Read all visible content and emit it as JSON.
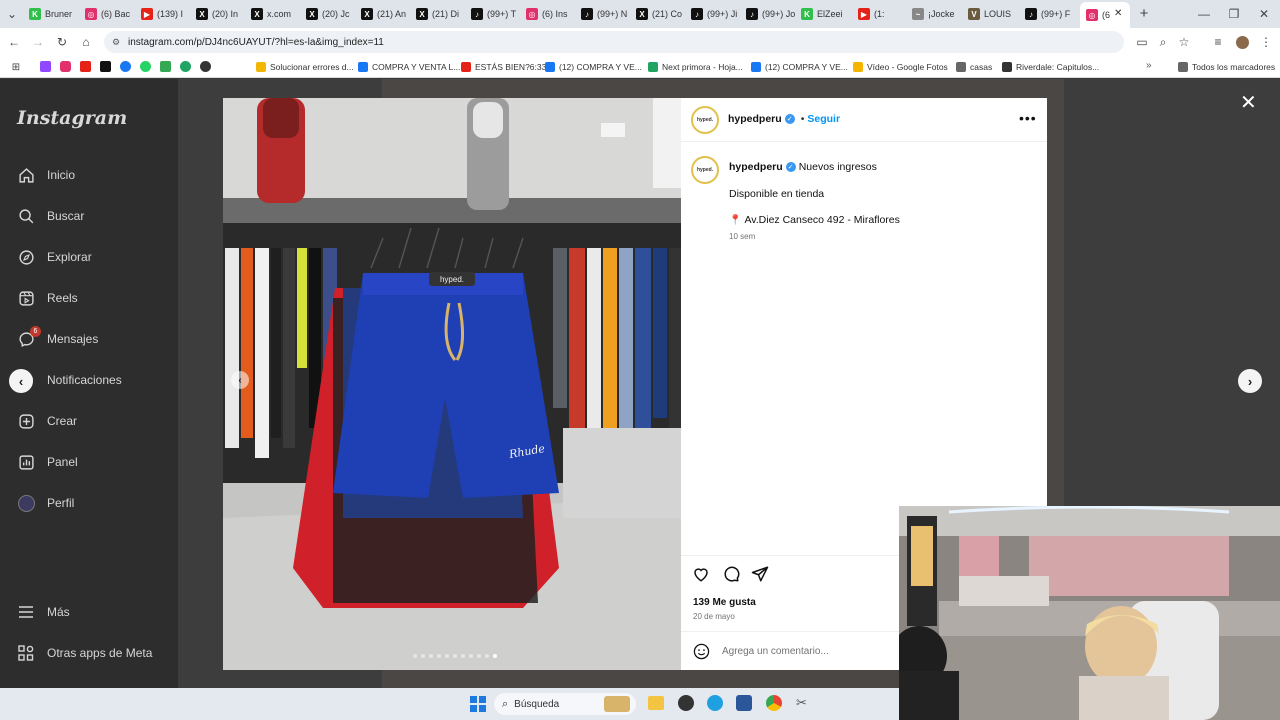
{
  "browser": {
    "tabs": [
      {
        "label": "Bruner",
        "color": "#2fbf4a",
        "glyph": "K"
      },
      {
        "label": "(6) Bac",
        "color": "#e1306c",
        "glyph": "◎"
      },
      {
        "label": "(139) I",
        "color": "#e62117",
        "glyph": "▶"
      },
      {
        "label": "(20) In",
        "color": "#111111",
        "glyph": "X"
      },
      {
        "label": "x.com",
        "color": "#111111",
        "glyph": "X"
      },
      {
        "label": "(20) Jc",
        "color": "#111111",
        "glyph": "X"
      },
      {
        "label": "(21) An",
        "color": "#111111",
        "glyph": "X"
      },
      {
        "label": "(21) Di",
        "color": "#111111",
        "glyph": "X"
      },
      {
        "label": "(99+) T",
        "color": "#111111",
        "glyph": "♪"
      },
      {
        "label": "(6) Ins",
        "color": "#e1306c",
        "glyph": "◎"
      },
      {
        "label": "(99+) N",
        "color": "#111111",
        "glyph": "♪"
      },
      {
        "label": "(21) Co",
        "color": "#111111",
        "glyph": "X"
      },
      {
        "label": "(99+) Ji",
        "color": "#111111",
        "glyph": "♪"
      },
      {
        "label": "(99+) Jo",
        "color": "#111111",
        "glyph": "♪"
      },
      {
        "label": "ElZeei",
        "color": "#2fbf4a",
        "glyph": "K"
      },
      {
        "label": "(1:",
        "color": "#e62117",
        "glyph": "▶"
      },
      {
        "label": "¡Jocke",
        "color": "#888888",
        "glyph": "~"
      },
      {
        "label": "LOUIS",
        "color": "#6b5b3e",
        "glyph": "V"
      },
      {
        "label": "(99+) F",
        "color": "#111111",
        "glyph": "♪"
      },
      {
        "label": "(6",
        "color": "#e1306c",
        "glyph": "◎"
      }
    ],
    "url": "instagram.com/p/DJ4nc6UAYUT/?hl=es-la&img_index=11",
    "bookmarks": [
      {
        "label": "Solucionar errores d...",
        "color": "#f2b705"
      },
      {
        "label": "COMPRA Y VENTA L...",
        "color": "#1877f2"
      },
      {
        "label": "ESTÁS BIEN?6:33",
        "color": "#e62117"
      },
      {
        "label": "(12) COMPRA Y VE...",
        "color": "#1877f2"
      },
      {
        "label": "Next primora - Hoja...",
        "color": "#1fa463"
      },
      {
        "label": "(12) COMPRA Y VE...",
        "color": "#1877f2"
      },
      {
        "label": "Vídeo - Google Fotos",
        "color": "#f4b400"
      },
      {
        "label": "casas",
        "color": "#666666"
      },
      {
        "label": "Riverdale: Capitulos...",
        "color": "#333333"
      },
      {
        "label": "Todos los marcadores",
        "color": "#666666"
      }
    ]
  },
  "sidebar": {
    "logo": "Instagram",
    "items": [
      {
        "label": "Inicio",
        "icon": "home-icon"
      },
      {
        "label": "Buscar",
        "icon": "search-icon"
      },
      {
        "label": "Explorar",
        "icon": "compass-icon"
      },
      {
        "label": "Reels",
        "icon": "reels-icon"
      },
      {
        "label": "Mensajes",
        "icon": "messenger-icon",
        "badge": "6"
      },
      {
        "label": "Notificaciones",
        "icon": "heart-icon"
      },
      {
        "label": "Crear",
        "icon": "plus-square-icon"
      },
      {
        "label": "Panel",
        "icon": "chart-icon"
      },
      {
        "label": "Perfil",
        "icon": "profile-avatar-icon"
      }
    ],
    "more": "Más",
    "meta": "Otras apps de Meta"
  },
  "post": {
    "username": "hypedperu",
    "avatar_text": "hyped.",
    "follow": "Seguir",
    "caption_line1": "Nuevos ingresos",
    "caption_line2": "Disponible en tienda",
    "caption_line3": "Av.Diez Canseco 492 - Miraflores",
    "time_ago": "10 sem",
    "likes": "139 Me gusta",
    "date": "20 de mayo",
    "comment_placeholder": "Agrega un comentario...",
    "image_count": 11,
    "active_index": 11,
    "shorts_brand": "hyped.",
    "shorts_logo": "Rhude"
  },
  "taskbar": {
    "search": "Búsqueda"
  },
  "colors": {
    "accent": "#0095f6",
    "verified": "#3897f0",
    "shorts": "#1f3fb5",
    "jacket": "#d0202a"
  }
}
